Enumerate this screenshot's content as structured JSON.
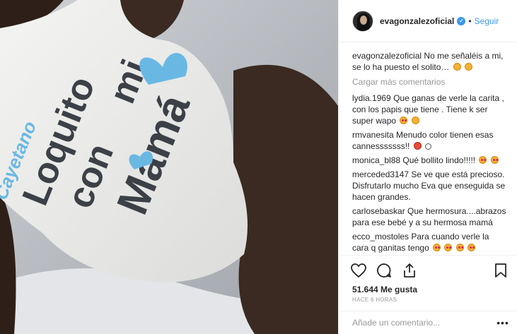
{
  "photo": {
    "label_name": "Cayetano",
    "shirt_text": [
      "Loquito",
      "con",
      "mi",
      "Mamá"
    ],
    "colors": {
      "print_dark": "#3c4047",
      "print_blue": "#69b8e4",
      "shirt": "#eeeeec",
      "skin": "#3a2a21"
    }
  },
  "header": {
    "username": "evagonzalezoficial",
    "verified_glyph": "✓",
    "separator": "•",
    "follow_label": "Seguir"
  },
  "caption": {
    "author": "evagonzalezoficial",
    "text": "No me señaléis a mi, se lo ha puesto el solito…"
  },
  "load_more_label": "Cargar más comentarios",
  "comments": [
    {
      "author": "lydia.1969",
      "text": "Que ganas de verle la carita , con los papis que tiene . Tiene k ser super wapo"
    },
    {
      "author": "rmvanesita",
      "text": "Menudo color tienen esas cannesssssss!!"
    },
    {
      "author": "monica_bl88",
      "text": "Qué bollito lindo!!!!!"
    },
    {
      "author": "merceded3147",
      "text": "Se ve que está precioso. Disfrutarlo mucho Eva que enseguida se hacen grandes."
    },
    {
      "author": "carlosebaskar",
      "text": "Que hermosura....abrazos para ese bebé y a su hermosa mamá"
    },
    {
      "author": "ecco_mostoles",
      "text": "Para cuando verle la cara q ganitas tengo"
    }
  ],
  "actions": {
    "like_icon": "heart-icon",
    "comment_icon": "comment-icon",
    "share_icon": "share-icon",
    "save_icon": "bookmark-icon"
  },
  "likes_text": "51.644 Me gusta",
  "time_text": "HACE 6 HORAS",
  "comment_box": {
    "placeholder": "Añade un comentario...",
    "more_glyph": "•••"
  },
  "colors": {
    "accent": "#3897f0",
    "muted": "#999999",
    "text": "#262626",
    "border": "#efefef"
  }
}
